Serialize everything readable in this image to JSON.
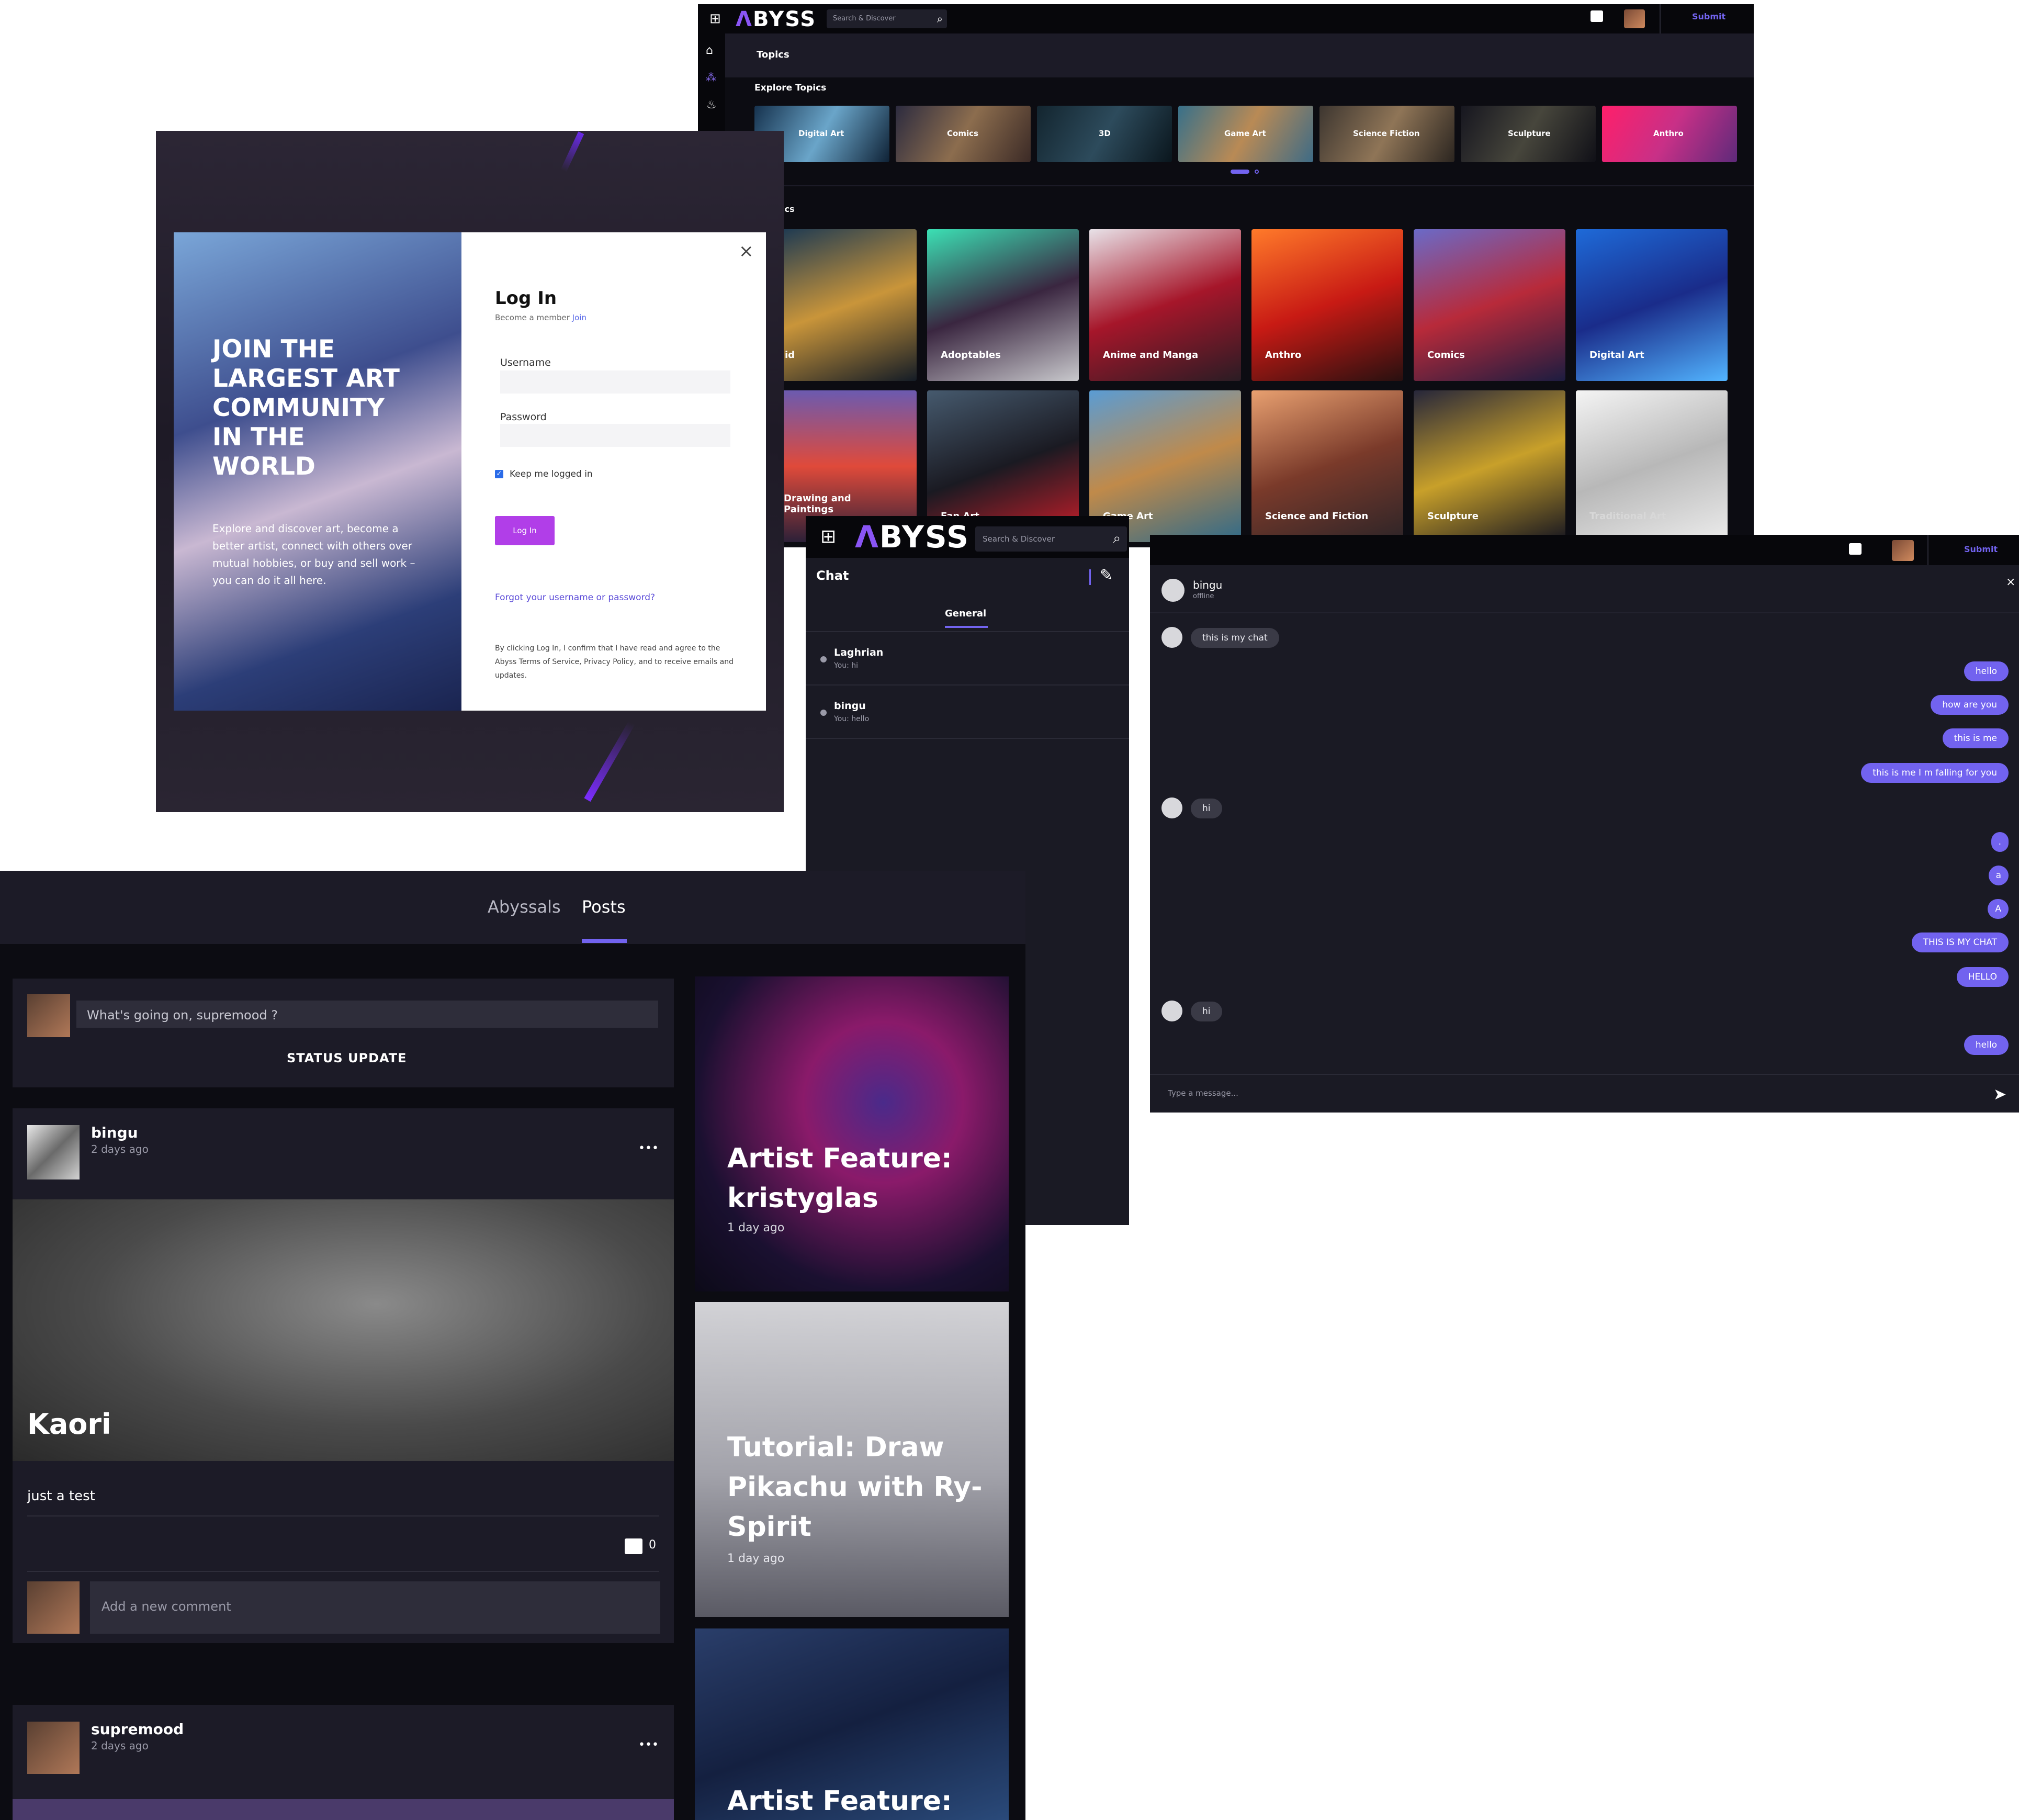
{
  "colors": {
    "accent": "#7263ef",
    "login_btn": "#b13ee8",
    "dark_bg": "#0f0f16",
    "panel_bg": "#1b1a26",
    "chat_bg": "#1a1a24"
  },
  "topics_page": {
    "brand": "BYSS",
    "search_placeholder": "Search & Discover",
    "submit": "Submit",
    "page_title": "Topics",
    "explore_title": "Explore Topics",
    "carousel": [
      "Digital Art",
      "Comics",
      "3D",
      "Game Art",
      "Science Fiction",
      "Sculpture",
      "Anthro"
    ],
    "all_topics_partial": "ics",
    "grid_row1": [
      "id",
      "Adoptables",
      "Anime and Manga",
      "Anthro",
      "Comics",
      "Digital Art"
    ],
    "grid_row2": [
      "Drawing and Paintings",
      "Fan Art",
      "Game Art",
      "Science and Fiction",
      "Sculpture",
      "Traditional Art"
    ]
  },
  "login": {
    "headline": "JOIN THE LARGEST ART COMMUNITY IN THE WORLD",
    "blurb": "Explore and discover art, become a better artist, connect with others over mutual hobbies, or buy and sell work – you can do it all here.",
    "close": "×",
    "title": "Log In",
    "become_member": "Become a member",
    "join": "Join",
    "username_label": "Username",
    "password_label": "Password",
    "keep_logged": "Keep me logged in",
    "button": "Log In",
    "forgot": "Forgot your username or password?",
    "legal": "By clicking Log In, I confirm that I have read and agree to the Abyss Terms of Service, Privacy Policy, and to receive emails and updates."
  },
  "chat_list": {
    "brand": "BYSS",
    "search_placeholder": "Search & Discover",
    "title": "Chat",
    "tab": "General",
    "items": [
      {
        "name": "Laghrian",
        "preview": "You: hi"
      },
      {
        "name": "bingu",
        "preview": "You: hello"
      }
    ]
  },
  "chat_window": {
    "submit": "Submit",
    "user": "bingu",
    "status": "offline",
    "close": "×",
    "placeholder": "Type a message...",
    "messages": [
      {
        "side": "left",
        "text": "this is my chat"
      },
      {
        "side": "right",
        "text": "hello"
      },
      {
        "side": "right",
        "text": "how are you"
      },
      {
        "side": "right",
        "text": "this is me"
      },
      {
        "side": "right",
        "text": "this is me I m falling for you"
      },
      {
        "side": "left",
        "text": "hi"
      },
      {
        "side": "right",
        "text": "."
      },
      {
        "side": "right",
        "text": "a"
      },
      {
        "side": "right",
        "text": "A"
      },
      {
        "side": "right",
        "text": "THIS IS MY CHAT"
      },
      {
        "side": "right",
        "text": "HELLO"
      },
      {
        "side": "left",
        "text": "hi"
      },
      {
        "side": "right",
        "text": "hello"
      }
    ]
  },
  "feed": {
    "tabs": [
      "Abyssals",
      "Posts"
    ],
    "composer_placeholder": "What's going on, supremood ?",
    "status_update": "STATUS UPDATE",
    "post1": {
      "author": "bingu",
      "time": "2 days ago",
      "more": "•••",
      "image_title": "Kaori",
      "caption": "just a test",
      "comments": "0",
      "comment_placeholder": "Add a new comment"
    },
    "post2": {
      "author": "supremood",
      "time": "2 days ago",
      "more": "•••"
    },
    "features": [
      {
        "title": "Artist Feature: kristyglas",
        "time": "1 day ago"
      },
      {
        "title": "Tutorial: Draw Pikachu with Ry-Spirit",
        "time": "1 day ago"
      },
      {
        "title": "Artist Feature:",
        "time": ""
      }
    ]
  }
}
